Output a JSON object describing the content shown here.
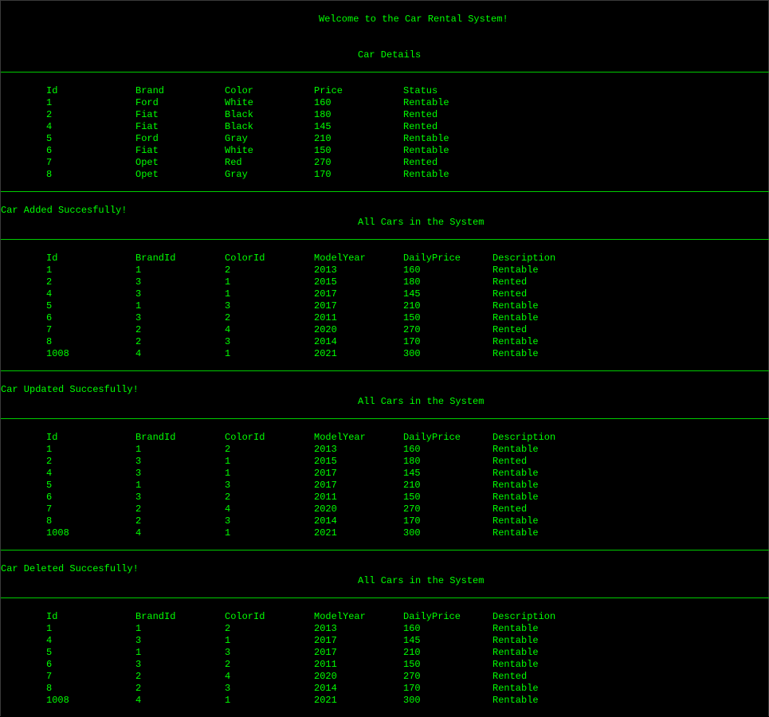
{
  "welcome": "Welcome to the Car Rental System!",
  "section1": {
    "title": "Car Details",
    "headers": [
      "Id",
      "Brand",
      "Color",
      "Price",
      "Status"
    ],
    "rows": [
      [
        "1",
        "Ford",
        "White",
        "160",
        "Rentable"
      ],
      [
        "2",
        "Fiat",
        "Black",
        "180",
        "Rented"
      ],
      [
        "4",
        "Fiat",
        "Black",
        "145",
        "Rented"
      ],
      [
        "5",
        "Ford",
        "Gray",
        "210",
        "Rentable"
      ],
      [
        "6",
        "Fiat",
        "White",
        "150",
        "Rentable"
      ],
      [
        "7",
        "Opet",
        "Red",
        "270",
        "Rented"
      ],
      [
        "8",
        "Opet",
        "Gray",
        "170",
        "Rentable"
      ]
    ]
  },
  "section2": {
    "message": "Car Added Succesfully!",
    "title": "All Cars in the System",
    "headers": [
      "Id",
      "BrandId",
      "ColorId",
      "ModelYear",
      "DailyPrice",
      "Description"
    ],
    "rows": [
      [
        "1",
        "1",
        "2",
        "2013",
        "160",
        "Rentable"
      ],
      [
        "2",
        "3",
        "1",
        "2015",
        "180",
        "Rented"
      ],
      [
        "4",
        "3",
        "1",
        "2017",
        "145",
        "Rented"
      ],
      [
        "5",
        "1",
        "3",
        "2017",
        "210",
        "Rentable"
      ],
      [
        "6",
        "3",
        "2",
        "2011",
        "150",
        "Rentable"
      ],
      [
        "7",
        "2",
        "4",
        "2020",
        "270",
        "Rented"
      ],
      [
        "8",
        "2",
        "3",
        "2014",
        "170",
        "Rentable"
      ],
      [
        "1008",
        "4",
        "1",
        "2021",
        "300",
        "Rentable"
      ]
    ]
  },
  "section3": {
    "message": "Car Updated Succesfully!",
    "title": "All Cars in the System",
    "headers": [
      "Id",
      "BrandId",
      "ColorId",
      "ModelYear",
      "DailyPrice",
      "Description"
    ],
    "rows": [
      [
        "1",
        "1",
        "2",
        "2013",
        "160",
        "Rentable"
      ],
      [
        "2",
        "3",
        "1",
        "2015",
        "180",
        "Rented"
      ],
      [
        "4",
        "3",
        "1",
        "2017",
        "145",
        "Rentable"
      ],
      [
        "5",
        "1",
        "3",
        "2017",
        "210",
        "Rentable"
      ],
      [
        "6",
        "3",
        "2",
        "2011",
        "150",
        "Rentable"
      ],
      [
        "7",
        "2",
        "4",
        "2020",
        "270",
        "Rented"
      ],
      [
        "8",
        "2",
        "3",
        "2014",
        "170",
        "Rentable"
      ],
      [
        "1008",
        "4",
        "1",
        "2021",
        "300",
        "Rentable"
      ]
    ]
  },
  "section4": {
    "message": "Car Deleted Succesfully!",
    "title": "All Cars in the System",
    "headers": [
      "Id",
      "BrandId",
      "ColorId",
      "ModelYear",
      "DailyPrice",
      "Description"
    ],
    "rows": [
      [
        "1",
        "1",
        "2",
        "2013",
        "160",
        "Rentable"
      ],
      [
        "4",
        "3",
        "1",
        "2017",
        "145",
        "Rentable"
      ],
      [
        "5",
        "1",
        "3",
        "2017",
        "210",
        "Rentable"
      ],
      [
        "6",
        "3",
        "2",
        "2011",
        "150",
        "Rentable"
      ],
      [
        "7",
        "2",
        "4",
        "2020",
        "270",
        "Rented"
      ],
      [
        "8",
        "2",
        "3",
        "2014",
        "170",
        "Rentable"
      ],
      [
        "1008",
        "4",
        "1",
        "2021",
        "300",
        "Rentable"
      ]
    ]
  },
  "colors": {
    "background": "#000000",
    "text": "#00ff00",
    "rule": "#00cc00"
  }
}
